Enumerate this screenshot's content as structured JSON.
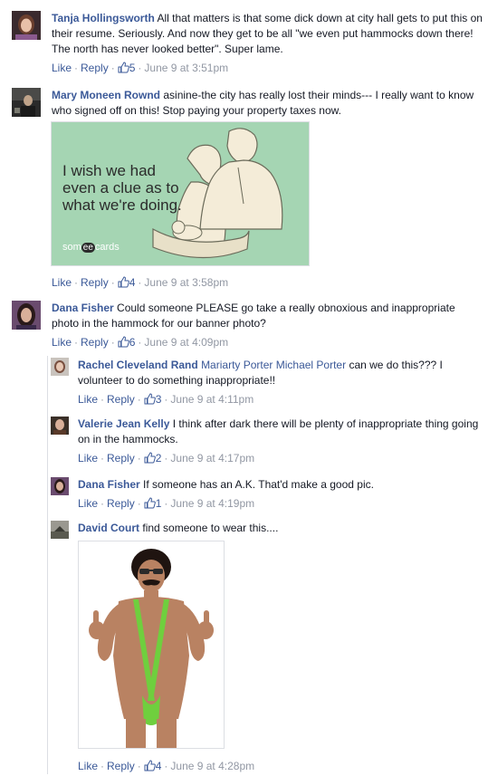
{
  "common": {
    "like": "Like",
    "reply": "Reply",
    "sep": "·"
  },
  "colors": {
    "link": "#3b5998",
    "meta": "#9197a3",
    "text": "#141823",
    "ecard_bg": "#a5d5b3"
  },
  "comments": [
    {
      "author": "Tanja Hollingsworth",
      "text": "All that matters is that some dick down at city hall gets to put this on their resume. Seriously. And now they get to be all \"we even put hammocks down there! The north has never looked better\". Super lame.",
      "likes": "5",
      "time": "June 9 at 3:51pm"
    },
    {
      "author": "Mary Moneen Rownd",
      "text": "asinine-the city has really lost their minds--- I really want to know who signed off on this! Stop paying your property taxes now.",
      "likes": "4",
      "time": "June 9 at 3:58pm",
      "ecard": {
        "line1": "I wish we had",
        "line2": "even a clue as to",
        "line3": "what we're doing.",
        "brand_pre": "som",
        "brand_mid": "ee",
        "brand_post": "cards"
      }
    },
    {
      "author": "Dana Fisher",
      "text": "Could someone PLEASE go take a really obnoxious and inappropriate photo in the hammock for our banner photo?",
      "likes": "6",
      "time": "June 9 at 4:09pm"
    }
  ],
  "replies": [
    {
      "author": "Rachel Cleveland Rand",
      "tags": "Mariarty Porter Michael Porter",
      "text": "can we do this??? I volunteer to do something inappropriate!!",
      "likes": "3",
      "time": "June 9 at 4:11pm"
    },
    {
      "author": "Valerie Jean Kelly",
      "text": "I think after dark there will be plenty of inappropriate thing going on in the hammocks.",
      "likes": "2",
      "time": "June 9 at 4:17pm"
    },
    {
      "author": "Dana Fisher",
      "text": "If someone has an A.K. That'd make a good pic.",
      "likes": "1",
      "time": "June 9 at 4:19pm"
    },
    {
      "author": "David Court",
      "text": "find someone to wear this....",
      "likes": "4",
      "time": "June 9 at 4:28pm"
    }
  ]
}
